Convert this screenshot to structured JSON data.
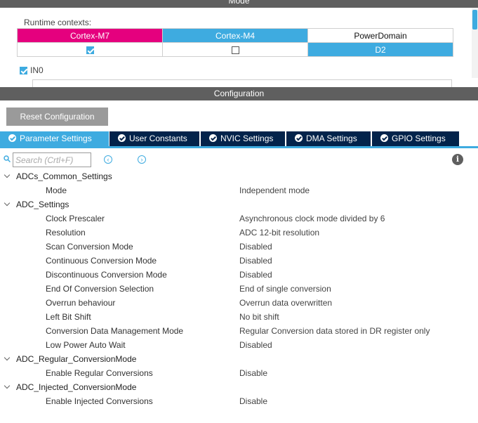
{
  "mode": {
    "header": "Mode",
    "runtime_contexts_label": "Runtime contexts:",
    "columns": [
      "Cortex-M7",
      "Cortex-M4",
      "PowerDomain"
    ],
    "cortex_m7_checked": true,
    "cortex_m4_checked": false,
    "power_domain_value": "D2",
    "in0_label": "IN0",
    "in0_checked": true
  },
  "config": {
    "header": "Configuration",
    "reset_button": "Reset Configuration",
    "tabs": [
      {
        "label": "Parameter Settings",
        "active": true
      },
      {
        "label": "User Constants",
        "active": false
      },
      {
        "label": "NVIC Settings",
        "active": false
      },
      {
        "label": "DMA Settings",
        "active": false
      },
      {
        "label": "GPIO Settings",
        "active": false
      }
    ],
    "search_placeholder": "Search (Crtl+F)",
    "info_icon": "i"
  },
  "tree": {
    "g0": {
      "name": "ADCs_Common_Settings"
    },
    "g0p0": {
      "name": "Mode",
      "value": "Independent mode"
    },
    "g1": {
      "name": "ADC_Settings"
    },
    "g1p0": {
      "name": "Clock Prescaler",
      "value": "Asynchronous clock mode divided by 6"
    },
    "g1p1": {
      "name": "Resolution",
      "value": "ADC 12-bit resolution"
    },
    "g1p2": {
      "name": "Scan Conversion Mode",
      "value": "Disabled"
    },
    "g1p3": {
      "name": "Continuous Conversion Mode",
      "value": "Disabled"
    },
    "g1p4": {
      "name": "Discontinuous Conversion Mode",
      "value": "Disabled"
    },
    "g1p5": {
      "name": "End Of Conversion Selection",
      "value": "End of single conversion"
    },
    "g1p6": {
      "name": "Overrun behaviour",
      "value": "Overrun data overwritten"
    },
    "g1p7": {
      "name": "Left Bit Shift",
      "value": "No bit shift"
    },
    "g1p8": {
      "name": "Conversion Data Management Mode",
      "value": "Regular Conversion data stored in DR register only"
    },
    "g1p9": {
      "name": "Low Power Auto Wait",
      "value": "Disabled"
    },
    "g2": {
      "name": "ADC_Regular_ConversionMode"
    },
    "g2p0": {
      "name": "Enable Regular Conversions",
      "value": "Disable"
    },
    "g3": {
      "name": "ADC_Injected_ConversionMode"
    },
    "g3p0": {
      "name": "Enable Injected Conversions",
      "value": "Disable"
    }
  },
  "colors": {
    "cortex_m7": "#e5007e",
    "cortex_m4": "#3eabe0",
    "tab_inactive": "#03234b",
    "tab_active": "#3eabe0"
  }
}
